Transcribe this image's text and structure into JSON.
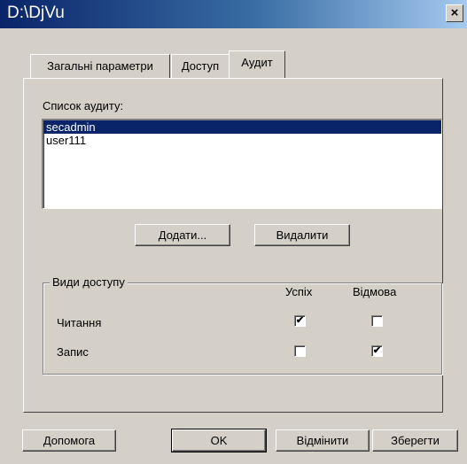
{
  "window": {
    "title": "D:\\DjVu",
    "close_glyph": "×"
  },
  "tabs": [
    {
      "label": "Загальні параметри",
      "active": false
    },
    {
      "label": "Доступ",
      "active": false
    },
    {
      "label": "Аудит",
      "active": true
    }
  ],
  "audit": {
    "list_label": "Список аудиту:",
    "items": [
      {
        "name": "secadmin",
        "selected": true
      },
      {
        "name": "user111",
        "selected": false
      }
    ],
    "add_button": "Додати...",
    "remove_button": "Видалити"
  },
  "access_types": {
    "group_label": "Види доступу",
    "col_success": "Успіх",
    "col_failure": "Відмова",
    "rows": [
      {
        "label": "Читання",
        "success": true,
        "failure": false
      },
      {
        "label": "Запис",
        "success": false,
        "failure": true
      }
    ]
  },
  "footer": {
    "help_button": "Допомога",
    "ok_button": "OK",
    "cancel_button": "Відмінити",
    "save_button": "Зберегти"
  },
  "checkmark_glyph": "✔"
}
